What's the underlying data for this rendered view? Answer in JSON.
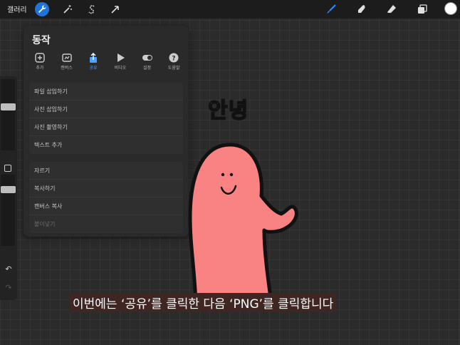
{
  "toolbar": {
    "gallery_label": "갤러리",
    "left_tools": [
      {
        "name": "actions",
        "icon": "wrench-icon",
        "active": true
      },
      {
        "name": "adjustments",
        "icon": "magic-wand-icon",
        "active": false
      },
      {
        "name": "selection",
        "icon": "selection-s-icon",
        "active": false
      },
      {
        "name": "transform",
        "icon": "arrow-cursor-icon",
        "active": false
      }
    ],
    "right_tools": [
      {
        "name": "brush",
        "icon": "brush-icon",
        "color": "#2f8bff"
      },
      {
        "name": "smudge",
        "icon": "smudge-icon",
        "color": "#e0e0e0"
      },
      {
        "name": "eraser",
        "icon": "eraser-icon",
        "color": "#e0e0e0"
      },
      {
        "name": "layers",
        "icon": "layers-icon",
        "color": "#e0e0e0"
      }
    ],
    "current_color": "#ffffff"
  },
  "actions_panel": {
    "title": "동작",
    "tabs": [
      {
        "label": "추가",
        "icon": "add-icon",
        "active": false
      },
      {
        "label": "캔버스",
        "icon": "canvas-icon",
        "active": false
      },
      {
        "label": "공유",
        "icon": "share-icon",
        "active": true
      },
      {
        "label": "비디오",
        "icon": "play-icon",
        "active": false
      },
      {
        "label": "설정",
        "icon": "toggle-icon",
        "active": false
      },
      {
        "label": "도움말",
        "icon": "help-icon",
        "active": false
      }
    ],
    "group1": [
      {
        "label": "파일 삽입하기",
        "disabled": false
      },
      {
        "label": "사진 삽입하기",
        "disabled": false
      },
      {
        "label": "사진 촬영하기",
        "disabled": false
      },
      {
        "label": "텍스트 추가",
        "disabled": false
      }
    ],
    "group2": [
      {
        "label": "자르기",
        "disabled": false
      },
      {
        "label": "복사하기",
        "disabled": false
      },
      {
        "label": "캔버스 복사",
        "disabled": false
      },
      {
        "label": "붙이넣기",
        "disabled": true
      }
    ]
  },
  "canvas": {
    "greeting_text": "안녕",
    "character_color": "#f98383"
  },
  "subtitle": "이번에는 ‘공유’를 클릭한 다음 ‘PNG’를 클릭합니다",
  "colors": {
    "accent": "#1f74d8",
    "share_tab": "#4aa3ff"
  }
}
